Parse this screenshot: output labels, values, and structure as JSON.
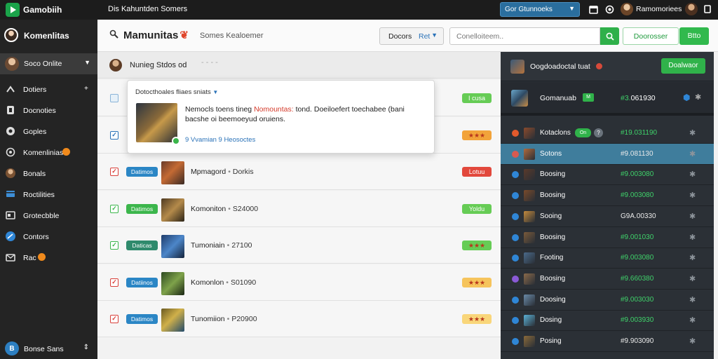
{
  "topbar": {
    "app_name": "Gamobiih",
    "title": "Dis Kahuntden Somers",
    "select_value": "Gor Gtunnoeks",
    "username": "Ramomoriees"
  },
  "sidebar": {
    "user_name": "Komenlitas",
    "selector_label": "Soco Onlite",
    "items": [
      {
        "label": "Dotiers",
        "icon": "controller-icon",
        "extra": "+"
      },
      {
        "label": "Docnoties",
        "icon": "document-icon",
        "extra": ""
      },
      {
        "label": "Goples",
        "icon": "pin-icon",
        "extra": ""
      },
      {
        "label": "Komenlinias",
        "icon": "target-icon",
        "extra": "badge"
      },
      {
        "label": "Bonals",
        "icon": "people-icon",
        "extra": ""
      },
      {
        "label": "Roctilities",
        "icon": "monitor-icon",
        "extra": ""
      },
      {
        "label": "Grotecbble",
        "icon": "tablet-icon",
        "extra": ""
      },
      {
        "label": "Contors",
        "icon": "globe-icon",
        "extra": ""
      },
      {
        "label": "Rac",
        "icon": "inbox-icon",
        "extra": "badge"
      }
    ],
    "footer_label": "Bonse Sans"
  },
  "header": {
    "title": "Mamunitas",
    "subtitle": "Somes Kealoemer",
    "dropdown_label": "Docors",
    "dropdown_value": "Ret",
    "search_placeholder": "Conelloiteem..",
    "btn_primary_outline": "Doorosser",
    "btn_primary": "Btto"
  },
  "list": {
    "header_label": "Nunieg Stdos od",
    "rows": [
      {
        "checked": false,
        "status": "",
        "status_color": "",
        "name": "",
        "value": "",
        "rating": "I cusa",
        "rating_color": "#66cc55"
      },
      {
        "checked": true,
        "status": "",
        "status_color": "",
        "name": "",
        "value": "",
        "rating": "★★★",
        "rating_color": "#f2a33a"
      },
      {
        "checked": true,
        "status": "Datimos",
        "status_color": "#2b86c5",
        "name": "Mpmagord",
        "value": "Dorkis",
        "rating": "Lotuu",
        "rating_color": "#e2483c"
      },
      {
        "checked": true,
        "status": "Datimos",
        "status_color": "#3cb64c",
        "name": "Komoniton",
        "value": "S24000",
        "rating": "Yoldu",
        "rating_color": "#66cc55"
      },
      {
        "checked": true,
        "status": "Daticas",
        "status_color": "#2f8a6c",
        "name": "Tumoniain",
        "value": "27100",
        "rating": "★★★",
        "rating_color": "#66cc55"
      },
      {
        "checked": true,
        "status": "Datiinos",
        "status_color": "#2b86c5",
        "name": "Komonlon",
        "value": "S01090",
        "rating": "★★★",
        "rating_color": "#f6c45c"
      },
      {
        "checked": true,
        "status": "Datimos",
        "status_color": "#2b86c5",
        "name": "Tunomiion",
        "value": "P20900",
        "rating": "★★★",
        "rating_color": "#f9d67a"
      }
    ]
  },
  "popover": {
    "header": "Dotocthoales fliaes sniats",
    "text_before": "Nemocls toens tineg",
    "text_red": "Nomountas:",
    "text_after": "tond. Doeiloefert toechabee (bani bacshe oi beemoeyud oruiens.",
    "meta": "9 Vvamian 9 Heosoctes"
  },
  "right_panel": {
    "header_label": "Oogdoadoctal tuat",
    "header_button": "Doalwaor",
    "featured": {
      "name": "Gomanuab",
      "tag": "M",
      "price_prefix": "#3.",
      "price": "061930"
    },
    "rows": [
      {
        "name": "Kotaclons",
        "price": "#19.031190",
        "selected": false,
        "dot_color": "#e25a2c",
        "price_green": true,
        "pill": "On",
        "has_q": true
      },
      {
        "name": "Sotons",
        "price": "#9.081130",
        "selected": true,
        "dot_color": "#d85a50",
        "price_green": false,
        "pill": "",
        "has_q": false
      },
      {
        "name": "Boosing",
        "price": "#9.003080",
        "selected": false,
        "dot_color": "#2f86d6",
        "price_green": true,
        "pill": "",
        "has_q": false
      },
      {
        "name": "Boosing",
        "price": "#9.003080",
        "selected": false,
        "dot_color": "#2f86d6",
        "price_green": true,
        "pill": "",
        "has_q": false
      },
      {
        "name": "Sooing",
        "price": "G9A.00330",
        "selected": false,
        "dot_color": "#2f86d6",
        "price_green": false,
        "pill": "",
        "has_q": false
      },
      {
        "name": "Boosing",
        "price": "#9.001030",
        "selected": false,
        "dot_color": "#2f86d6",
        "price_green": true,
        "pill": "",
        "has_q": false
      },
      {
        "name": "Footing",
        "price": "#9.003080",
        "selected": false,
        "dot_color": "#2f86d6",
        "price_green": true,
        "pill": "",
        "has_q": false
      },
      {
        "name": "Boosing",
        "price": "#9.660380",
        "selected": false,
        "dot_color": "#8a5ad6",
        "price_green": true,
        "pill": "",
        "has_q": false
      },
      {
        "name": "Doosing",
        "price": "#9.003030",
        "selected": false,
        "dot_color": "#2f86d6",
        "price_green": true,
        "pill": "",
        "has_q": false
      },
      {
        "name": "Dosing",
        "price": "#9.003930",
        "selected": false,
        "dot_color": "#2f86d6",
        "price_green": true,
        "pill": "",
        "has_q": false
      },
      {
        "name": "Posing",
        "price": "#9.903090",
        "selected": false,
        "dot_color": "#2f86d6",
        "price_green": false,
        "pill": "",
        "has_q": false
      }
    ]
  },
  "colors": {
    "accent_green": "#31b94d",
    "accent_blue": "#2a72b8",
    "sidebar_bg": "#242424",
    "panel_bg": "#2b3036",
    "selected_row": "#3f7d9c"
  }
}
